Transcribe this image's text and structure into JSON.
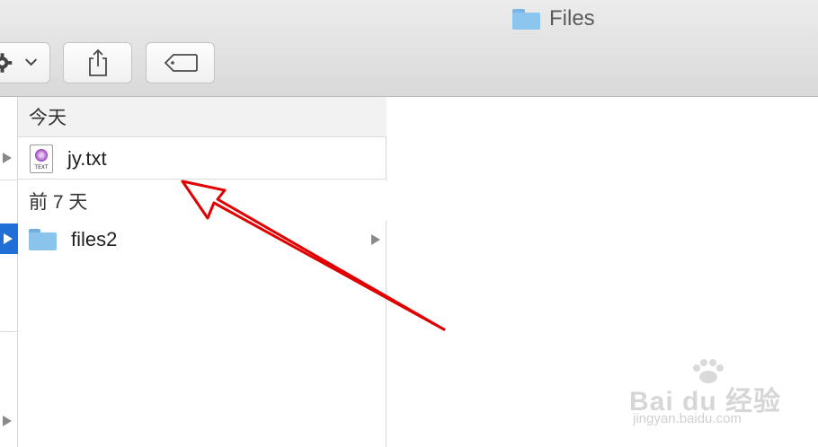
{
  "window": {
    "title": "Files"
  },
  "toolbar": {
    "buttons": [
      {
        "name": "action",
        "icon": "gear-icon"
      },
      {
        "name": "share",
        "icon": "share-icon"
      },
      {
        "name": "tag",
        "icon": "tag-icon"
      }
    ]
  },
  "browser": {
    "groups": [
      {
        "header": "今天",
        "items": [
          {
            "name": "jy.txt",
            "kind": "text",
            "icon_label": "TEXT"
          }
        ]
      },
      {
        "header": "前 7 天",
        "items": [
          {
            "name": "files2",
            "kind": "folder"
          }
        ]
      }
    ]
  },
  "colors": {
    "selection": "#1f6fd6",
    "folder": "#8ac4ec",
    "annotation_arrow": "#e00000"
  },
  "watermark": {
    "main": "Bai du 经验",
    "sub": "jingyan.baidu.com"
  }
}
